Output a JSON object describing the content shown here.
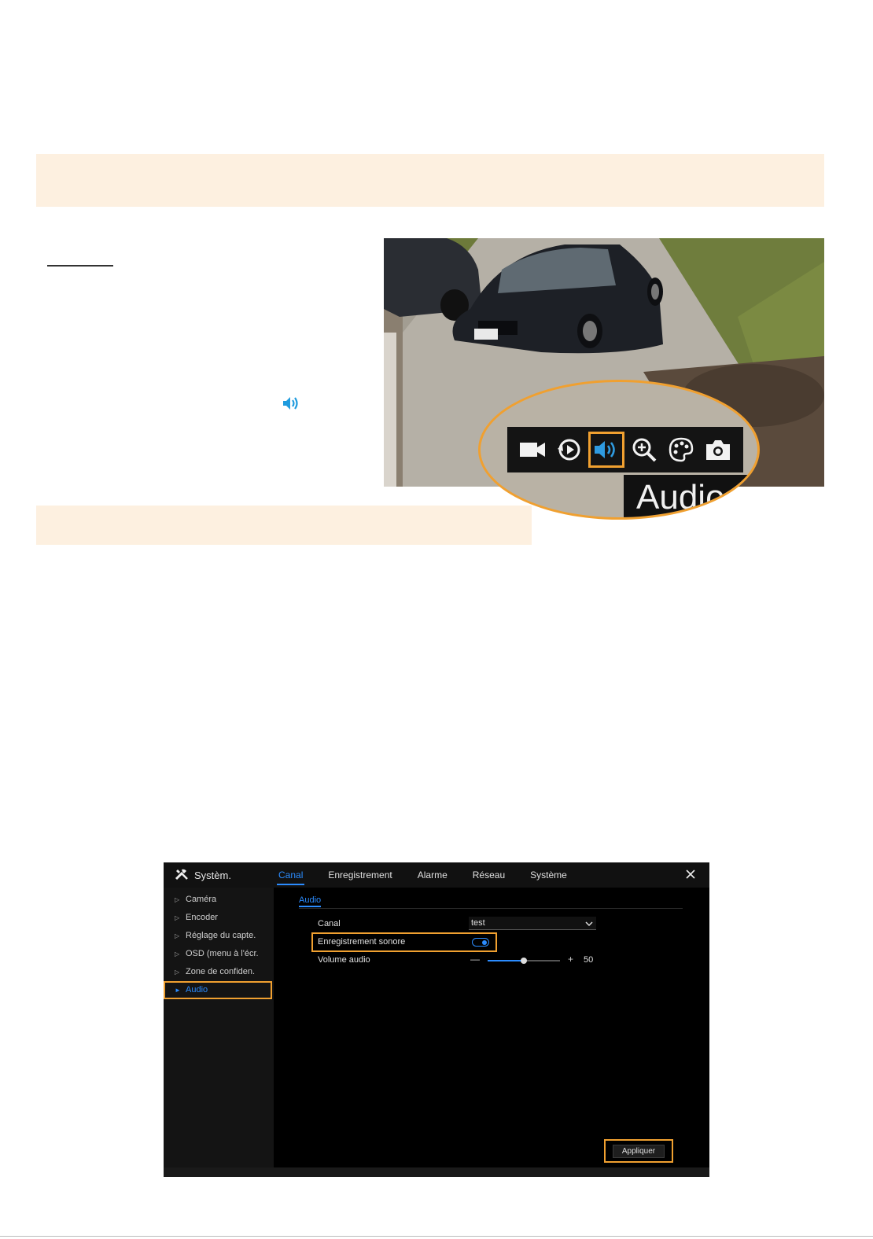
{
  "photo": {
    "callout": {
      "tooltip": "Audio",
      "icons": [
        "video-icon",
        "playback-icon",
        "speaker-icon",
        "zoom-in-icon",
        "color-palette-icon",
        "camera-snapshot-icon"
      ],
      "active_icon": "speaker-icon"
    }
  },
  "dvr": {
    "brand": "Systèm.",
    "tabs": [
      "Canal",
      "Enregistrement",
      "Alarme",
      "Réseau",
      "Système"
    ],
    "active_tab": "Canal",
    "sidebar": [
      {
        "label": "Caméra",
        "active": false
      },
      {
        "label": "Encoder",
        "active": false
      },
      {
        "label": "Réglage du capte.",
        "active": false
      },
      {
        "label": "OSD (menu à l'écr.",
        "active": false
      },
      {
        "label": "Zone de confiden.",
        "active": false
      },
      {
        "label": "Audio",
        "active": true
      }
    ],
    "section_tab": "Audio",
    "fields": {
      "canal_label": "Canal",
      "canal_value": "test",
      "record_label": "Enregistrement sonore",
      "record_enabled": true,
      "volume_label": "Volume audio",
      "volume_minus": "—",
      "volume_plus": "+",
      "volume_value": "50",
      "volume_fraction": 0.5
    },
    "apply_label": "Appliquer"
  },
  "colors": {
    "accent": "#2b8cff",
    "highlight": "#f0a030",
    "note_bg": "#fdf0e0"
  }
}
